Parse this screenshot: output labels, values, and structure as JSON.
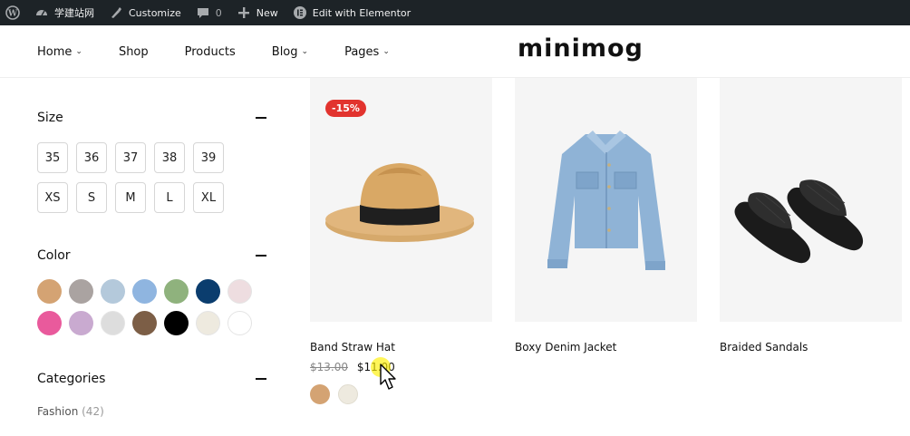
{
  "admin_bar": {
    "site_name": "学建站网",
    "customize": "Customize",
    "comments_count": "0",
    "new": "New",
    "elementor": "Edit with Elementor"
  },
  "nav": {
    "items": [
      {
        "label": "Home",
        "dropdown": true
      },
      {
        "label": "Shop",
        "dropdown": false
      },
      {
        "label": "Products",
        "dropdown": false
      },
      {
        "label": "Blog",
        "dropdown": true
      },
      {
        "label": "Pages",
        "dropdown": true
      }
    ]
  },
  "logo": "minimog",
  "filters": {
    "size": {
      "title": "Size",
      "options": [
        "35",
        "36",
        "37",
        "38",
        "39",
        "XS",
        "S",
        "M",
        "L",
        "XL"
      ]
    },
    "color": {
      "title": "Color",
      "swatches": [
        "#d4a373",
        "#aaa3a1",
        "#b4c9db",
        "#8fb5e0",
        "#8fb27d",
        "#0b3d6e",
        "#eedde0",
        "#e95a9c",
        "#c9aad0",
        "#dddddd",
        "#7c5e46",
        "#000000",
        "#eeeadf",
        "#ffffff"
      ]
    },
    "categories": {
      "title": "Categories",
      "items": [
        {
          "name": "Fashion",
          "count": "(42)"
        }
      ]
    }
  },
  "products": [
    {
      "title": "Band Straw Hat",
      "badge": "-15%",
      "old_price": "$13.00",
      "price": "$11.00",
      "swatches": [
        "#d4a373",
        "#eeeadf"
      ]
    },
    {
      "title": "Boxy Denim Jacket"
    },
    {
      "title": "Braided Sandals"
    }
  ]
}
